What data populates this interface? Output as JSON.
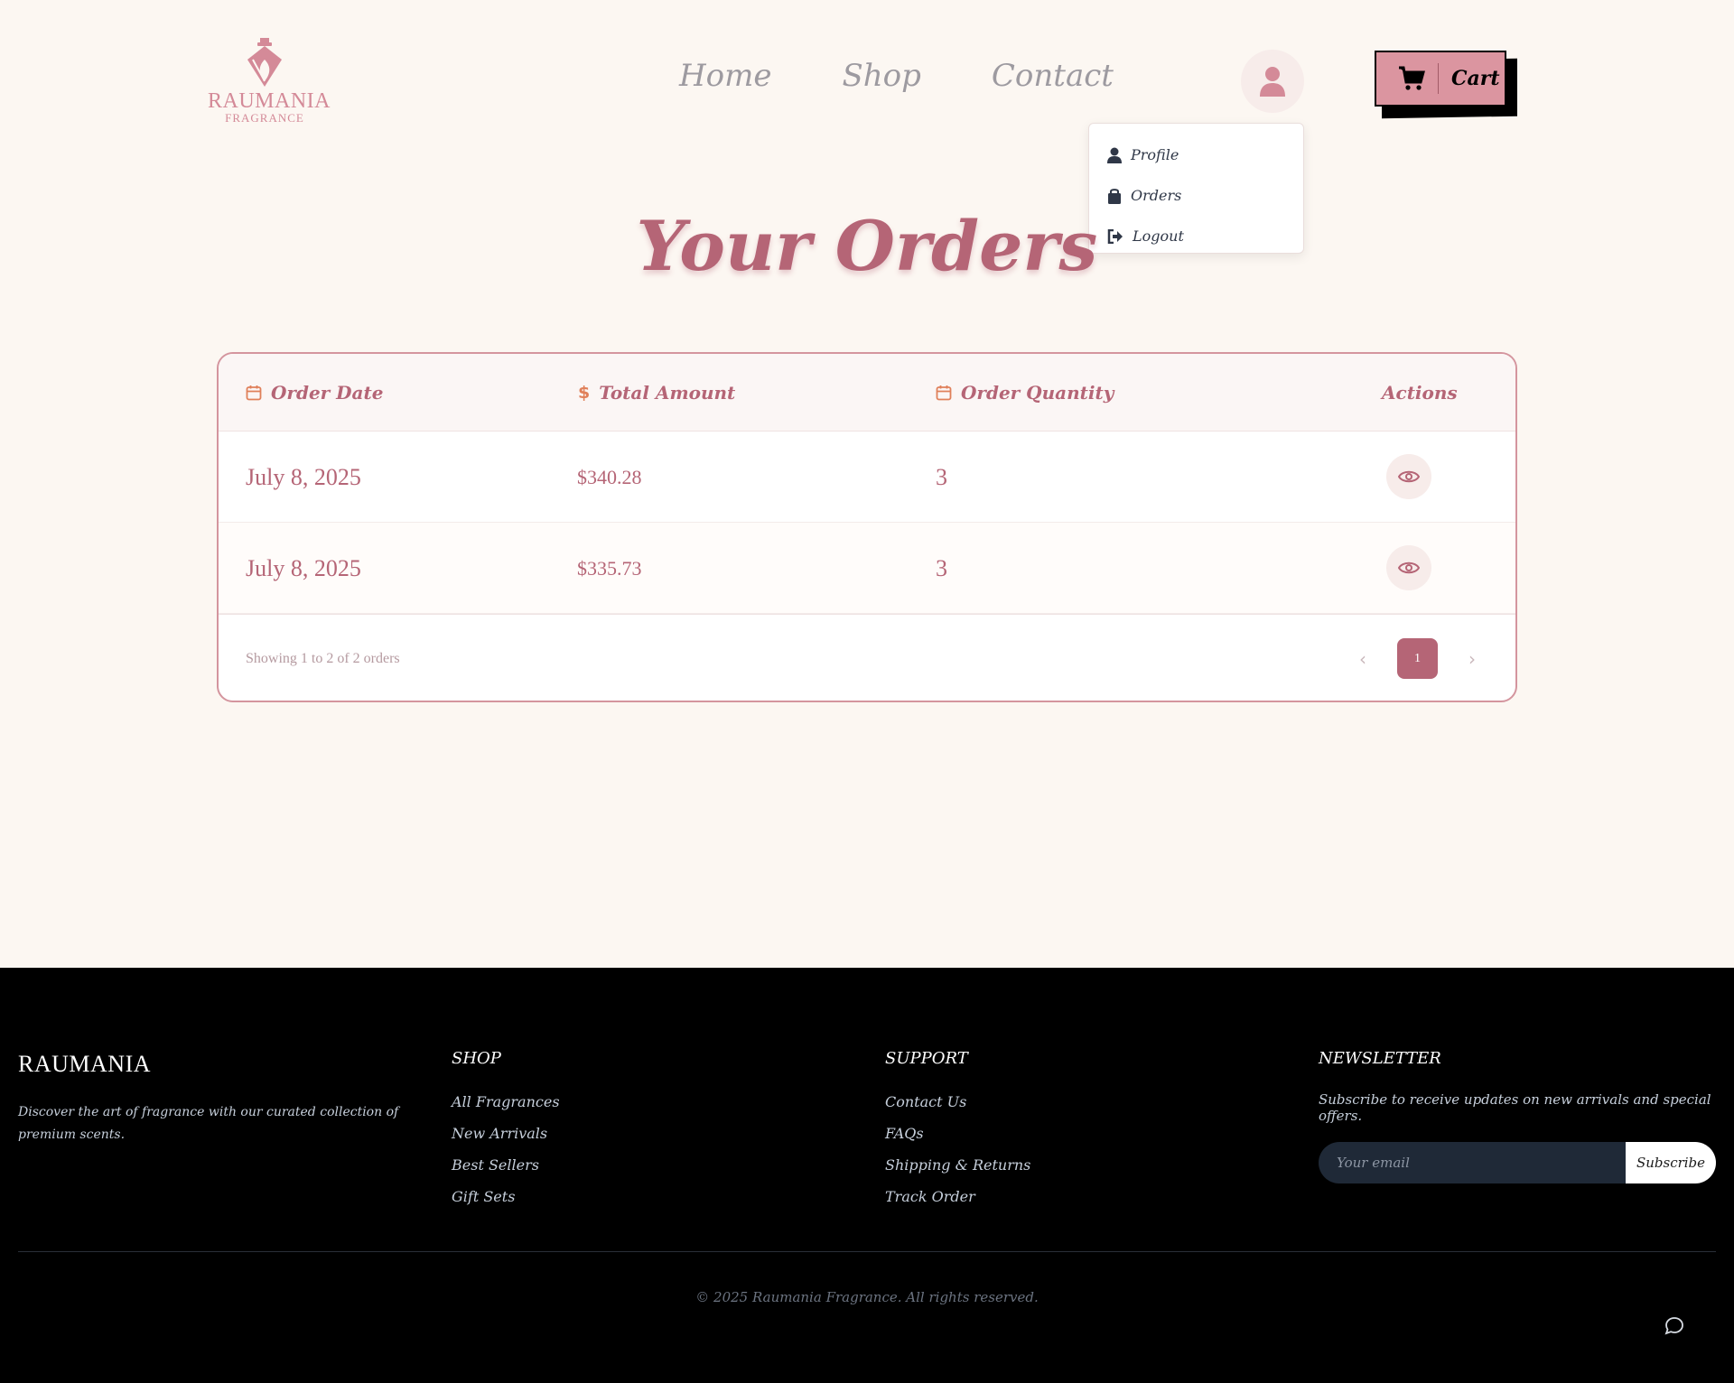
{
  "header": {
    "logo": {
      "brand": "RAUMANIA",
      "sub": "FRAGRANCE"
    },
    "nav": [
      {
        "label": "Home"
      },
      {
        "label": "Shop"
      },
      {
        "label": "Contact"
      }
    ],
    "profile_icon": "user-icon",
    "cart": {
      "label": "Cart",
      "icon": "cart-icon"
    }
  },
  "dropdown": {
    "items": [
      {
        "label": "Profile",
        "icon": "user-icon"
      },
      {
        "label": "Orders",
        "icon": "bag-icon"
      },
      {
        "label": "Logout",
        "icon": "logout-icon"
      }
    ]
  },
  "main": {
    "title": "Your Orders",
    "table": {
      "headers": {
        "date": "Order Date",
        "total": "Total Amount",
        "quantity": "Order Quantity",
        "actions": "Actions"
      },
      "rows": [
        {
          "date": "July 8, 2025",
          "total": "$340.28",
          "quantity": "3",
          "action_icon": "eye-icon"
        },
        {
          "date": "July 8, 2025",
          "total": "$335.73",
          "quantity": "3",
          "action_icon": "eye-icon"
        }
      ],
      "showing": "Showing 1 to 2 of 2 orders",
      "pagination": {
        "current": "1",
        "prev": "‹",
        "next": "›"
      }
    }
  },
  "footer": {
    "brand": "RAUMANIA",
    "description": "Discover the art of fragrance with our curated collection of premium scents.",
    "shop": {
      "heading": "SHOP",
      "links": [
        "All Fragrances",
        "New Arrivals",
        "Best Sellers",
        "Gift Sets"
      ]
    },
    "support": {
      "heading": "SUPPORT",
      "links": [
        "Contact Us",
        "FAQs",
        "Shipping & Returns",
        "Track Order"
      ]
    },
    "newsletter": {
      "heading": "NEWSLETTER",
      "text": "Subscribe to receive updates on new arrivals and special offers.",
      "placeholder": "Your email",
      "button": "Subscribe"
    },
    "copyright": "© 2025 Raumania Fragrance. All rights reserved."
  },
  "colors": {
    "accent": "#b56576",
    "background": "#fcf7f2",
    "icon_orange": "#e0805a",
    "cart": "#db95a0",
    "footer_bg": "#000000"
  }
}
